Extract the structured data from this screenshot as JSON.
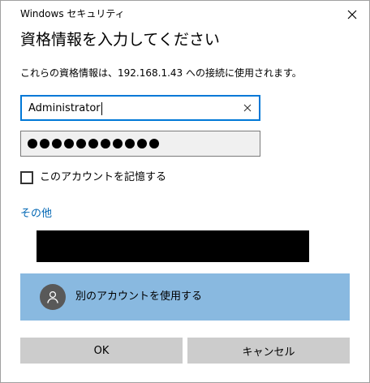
{
  "window": {
    "title": "Windows セキュリティ",
    "close_icon": "close-icon"
  },
  "dialog": {
    "heading": "資格情報を入力してください",
    "description": "これらの資格情報は、192.168.1.43 への接続に使用されます。"
  },
  "username": {
    "value": "Administrator",
    "clear_icon": "clear-icon"
  },
  "password": {
    "masked_length": 11
  },
  "remember": {
    "label": "このアカウントを記憶する",
    "checked": false
  },
  "more_choices": {
    "label": "その他"
  },
  "alt_account": {
    "label": "別のアカウントを使用する",
    "icon": "user-avatar-icon"
  },
  "buttons": {
    "ok": "OK",
    "cancel": "キャンセル"
  },
  "colors": {
    "focus_border": "#0078d7",
    "link": "#0066b4",
    "selected_option_bg": "#89b9e0",
    "button_bg": "#cccccc"
  }
}
